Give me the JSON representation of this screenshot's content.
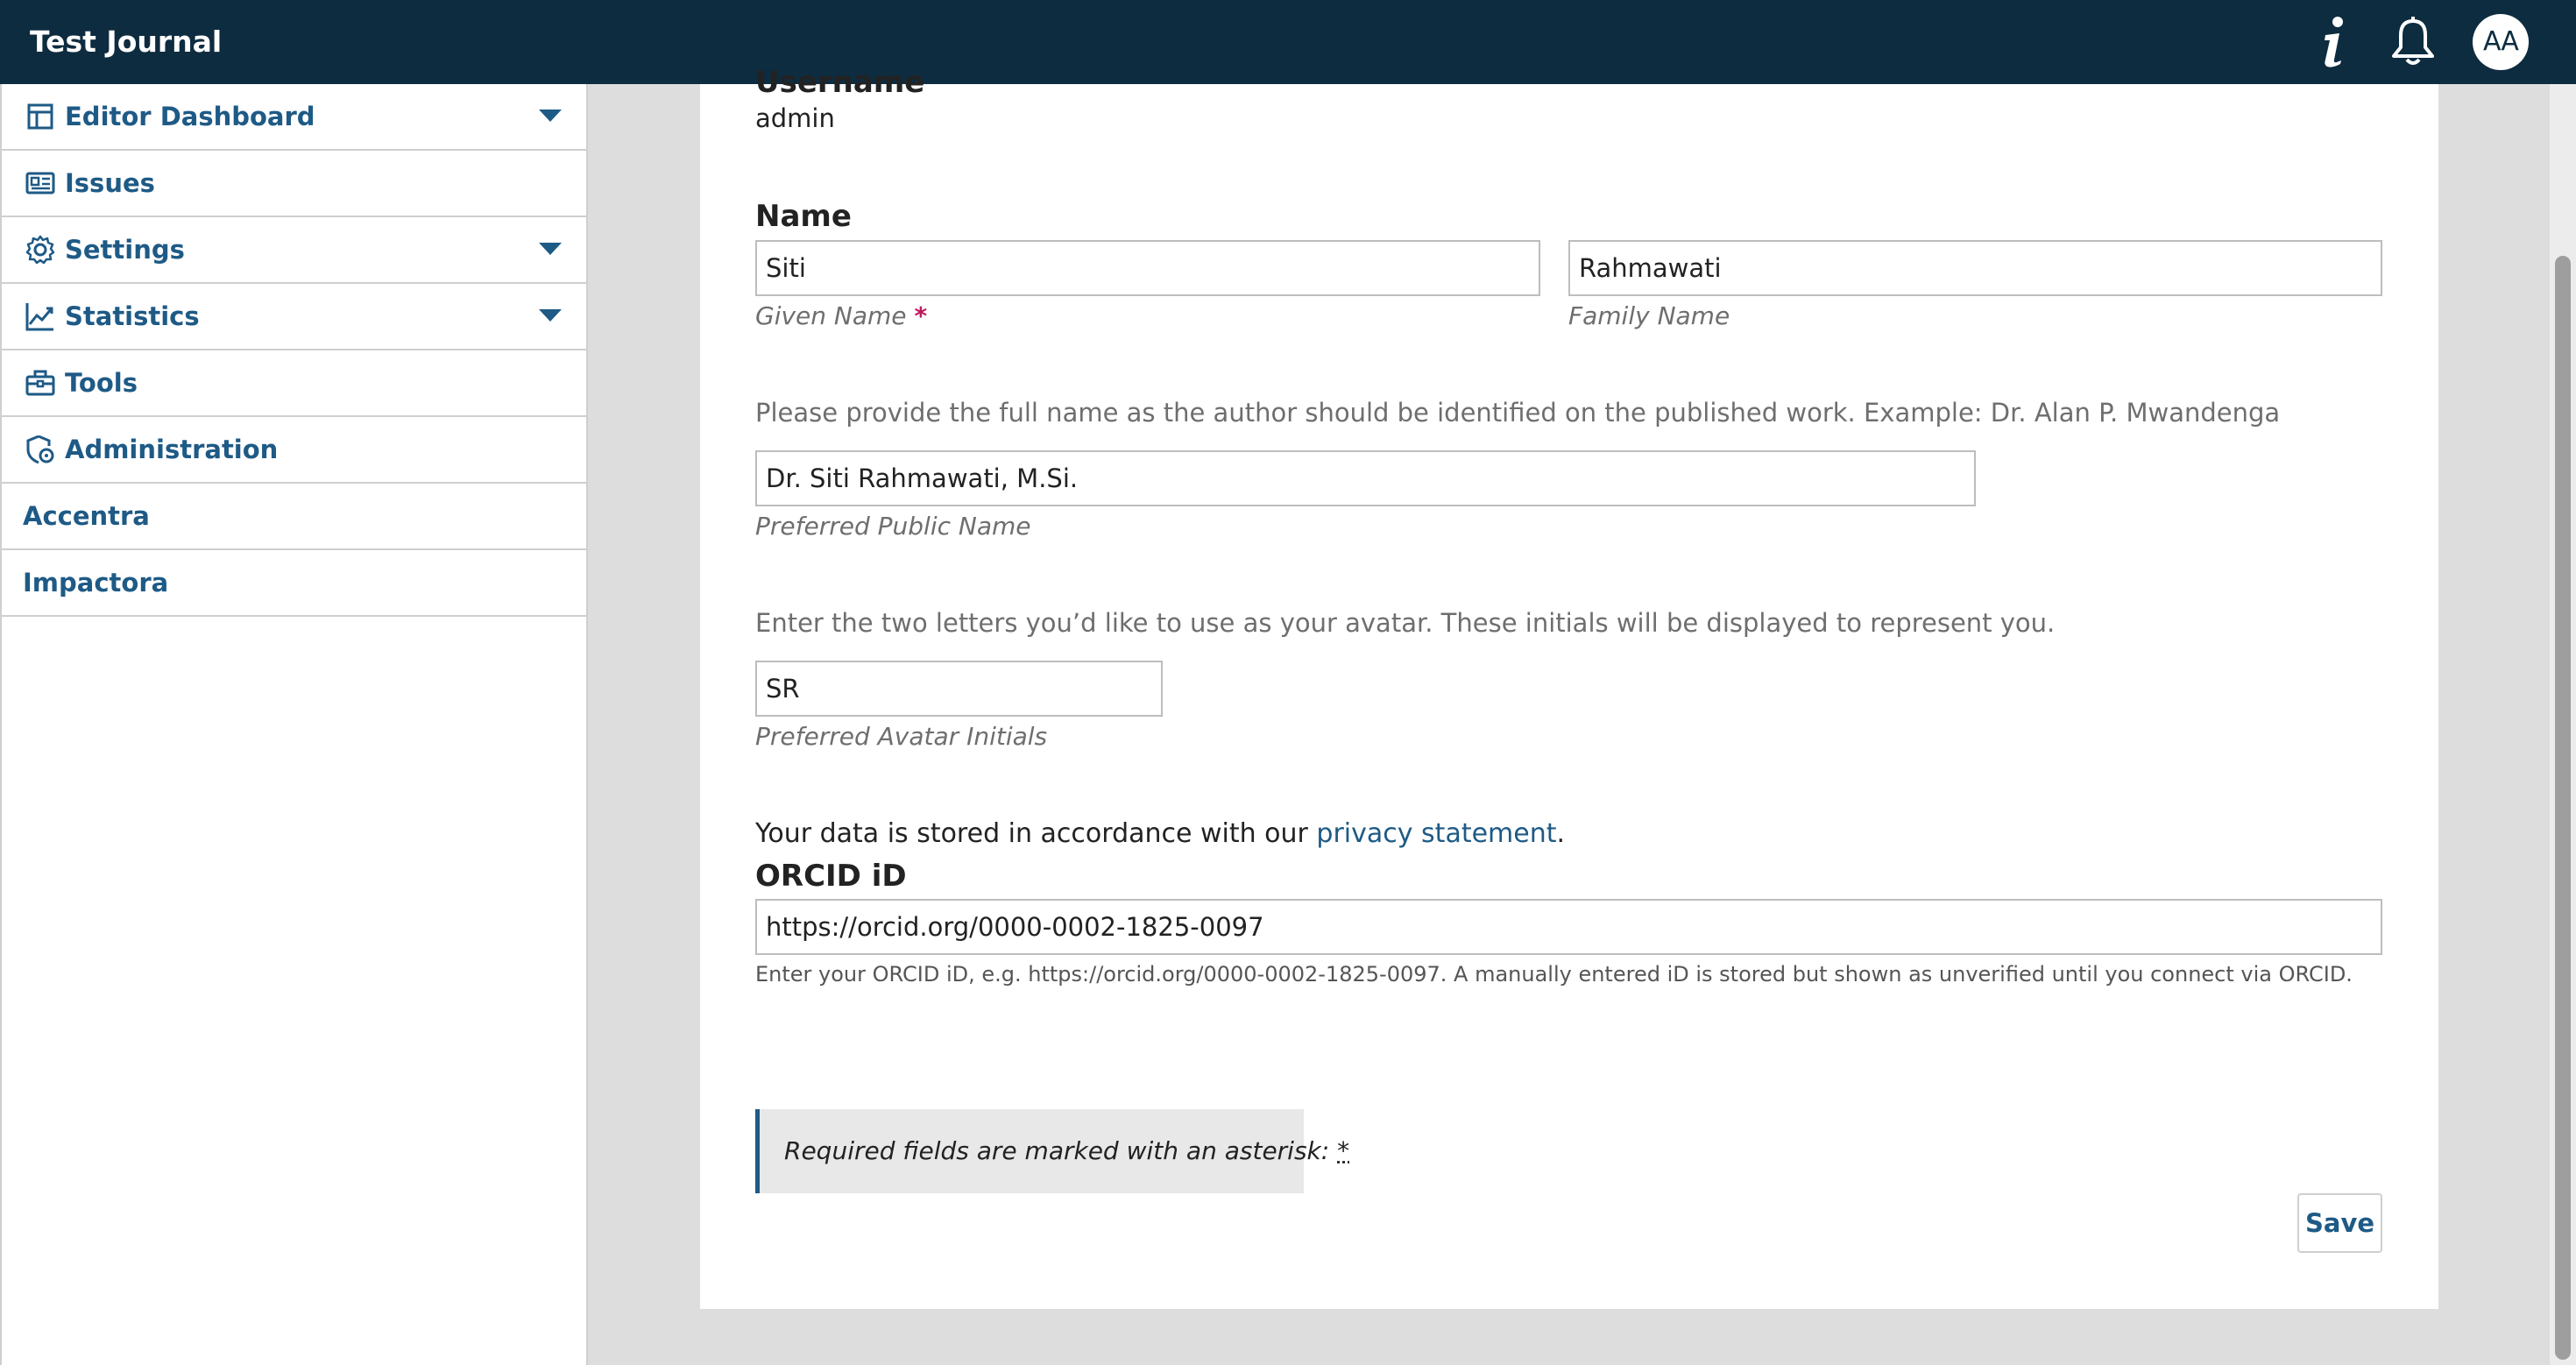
{
  "header": {
    "title": "Test Journal",
    "avatar_initials": "AA",
    "info_icon": "info-icon",
    "bell_icon": "bell-icon"
  },
  "sidebar": {
    "items": [
      {
        "label": "Editor Dashboard",
        "icon": "dashboard-icon",
        "expandable": true
      },
      {
        "label": "Issues",
        "icon": "issues-icon",
        "expandable": false
      },
      {
        "label": "Settings",
        "icon": "gear-icon",
        "expandable": true
      },
      {
        "label": "Statistics",
        "icon": "chart-line-icon",
        "expandable": true
      },
      {
        "label": "Tools",
        "icon": "toolbox-icon",
        "expandable": false
      },
      {
        "label": "Administration",
        "icon": "shield-icon",
        "expandable": false
      },
      {
        "label": "Accentra",
        "icon": "",
        "expandable": false
      },
      {
        "label": "Impactora",
        "icon": "",
        "expandable": false
      }
    ]
  },
  "form": {
    "username_heading": "Username",
    "username_value": "admin",
    "name_heading": "Name",
    "given_name_value": "Siti",
    "given_name_label": "Given Name",
    "required_marker": "*",
    "family_name_value": "Rahmawati",
    "family_name_label": "Family Name",
    "public_name_description": "Please provide the full name as the author should be identified on the published work. Example: Dr. Alan P. Mwandenga",
    "public_name_value": "Dr. Siti Rahmawati, M.Si.",
    "public_name_label": "Preferred Public Name",
    "initials_description": "Enter the two letters you’d like to use as your avatar. These initials will be displayed to represent you.",
    "initials_value": "SR",
    "initials_label": "Preferred Avatar Initials",
    "privacy_prefix": "Your data is stored in accordance with our ",
    "privacy_link": "privacy statement",
    "privacy_suffix": ".",
    "orcid_heading": "ORCID iD",
    "orcid_value": "https://orcid.org/0000-0002-1825-0097",
    "orcid_help": "Enter your ORCID iD, e.g. https://orcid.org/0000-0002-1825-0097. A manually entered iD is stored but shown as unverified until you connect via ORCID.",
    "required_notice": "Required fields are marked with an asterisk: ",
    "required_notice_marker": "*",
    "save_label": "Save"
  },
  "colors": {
    "topbar": "#0e2c40",
    "link": "#1e5a86",
    "required": "#c2185b"
  }
}
